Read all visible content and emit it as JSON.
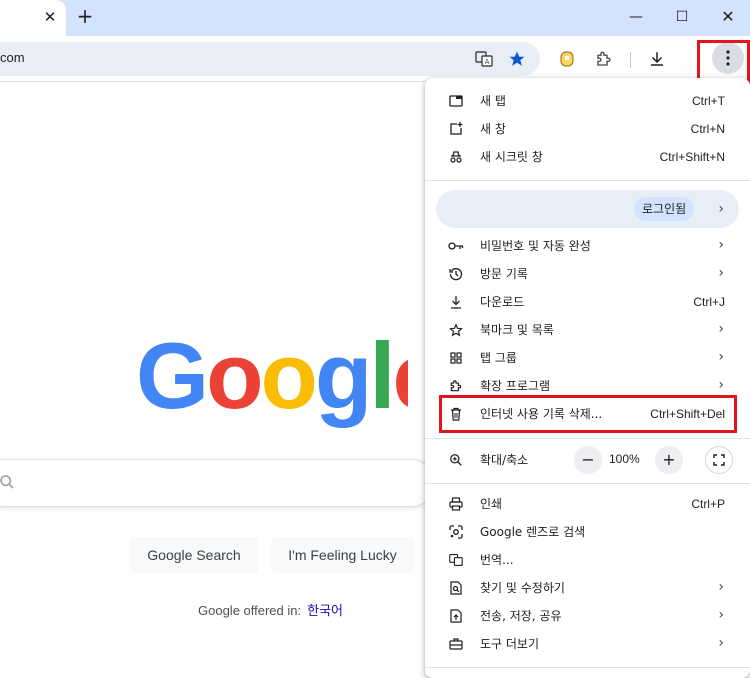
{
  "window": {
    "tab_close": "✕",
    "new_tab": "+",
    "minimize": "—",
    "maximize": "☐",
    "close": "✕"
  },
  "omnibox": {
    "text": "com"
  },
  "page": {
    "buttons": {
      "search": "Google Search",
      "lucky": "I'm Feeling Lucky"
    },
    "offered_in": "Google offered in:",
    "language_link": "한국어"
  },
  "menu": {
    "group1": [
      {
        "label": "새 탭",
        "shortcut": "Ctrl+T",
        "icon": "new-tab-icon"
      },
      {
        "label": "새 창",
        "shortcut": "Ctrl+N",
        "icon": "new-window-icon"
      },
      {
        "label": "새 시크릿 창",
        "shortcut": "Ctrl+Shift+N",
        "icon": "incognito-icon"
      }
    ],
    "profile": {
      "label": "로그인됨",
      "arrow": "›"
    },
    "group2": [
      {
        "label": "비밀번호 및 자동 완성",
        "arrow": "›",
        "icon": "key-icon"
      },
      {
        "label": "방문 기록",
        "arrow": "›",
        "icon": "history-icon"
      },
      {
        "label": "다운로드",
        "shortcut": "Ctrl+J",
        "icon": "download-icon"
      },
      {
        "label": "북마크 및 목록",
        "arrow": "›",
        "icon": "star-icon"
      },
      {
        "label": "탭 그룹",
        "arrow": "›",
        "icon": "tab-groups-icon"
      },
      {
        "label": "확장 프로그램",
        "arrow": "›",
        "icon": "extension-icon"
      },
      {
        "label": "인터넷 사용 기록 삭제...",
        "shortcut": "Ctrl+Shift+Del",
        "icon": "trash-icon"
      }
    ],
    "zoom": {
      "label": "확대/축소",
      "minus": "−",
      "value": "100%",
      "plus": "+"
    },
    "group3": [
      {
        "label": "인쇄",
        "shortcut": "Ctrl+P",
        "icon": "print-icon"
      },
      {
        "label": "Google 렌즈로 검색",
        "icon": "lens-icon"
      },
      {
        "label": "번역...",
        "icon": "translate-icon"
      },
      {
        "label": "찾기 및 수정하기",
        "arrow": "›",
        "icon": "find-icon"
      },
      {
        "label": "전송, 저장, 공유",
        "arrow": "›",
        "icon": "share-icon"
      },
      {
        "label": "도구 더보기",
        "arrow": "›",
        "icon": "toolbox-icon"
      }
    ]
  },
  "colors": {
    "highlight": "#e0151d",
    "blue": "#4285f4",
    "red": "#ea4335",
    "yellow": "#fbbc05",
    "green": "#34a853"
  }
}
